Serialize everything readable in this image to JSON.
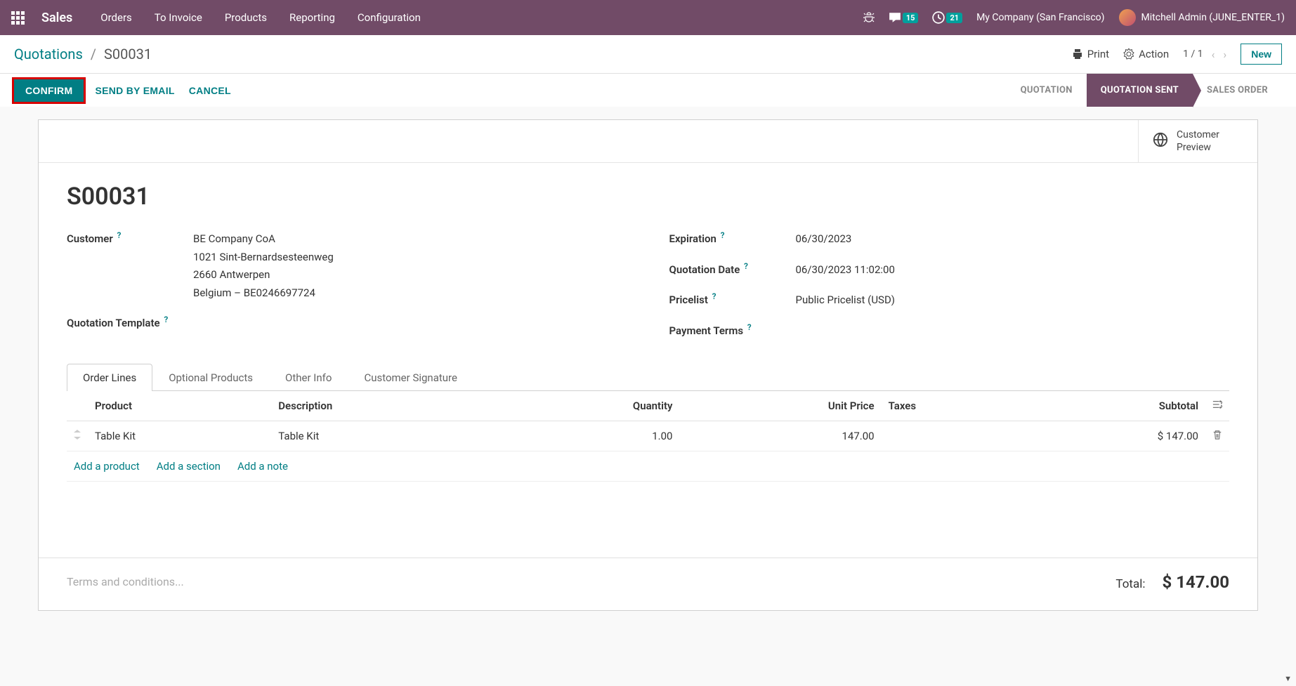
{
  "nav": {
    "app_name": "Sales",
    "menu": [
      "Orders",
      "To Invoice",
      "Products",
      "Reporting",
      "Configuration"
    ],
    "messages_count": "15",
    "activities_count": "21",
    "company": "My Company (San Francisco)",
    "user": "Mitchell Admin (JUNE_ENTER_1)"
  },
  "breadcrumb": {
    "root": "Quotations",
    "current": "S00031",
    "print": "Print",
    "action": "Action",
    "pager": "1 / 1",
    "new_btn": "New"
  },
  "actions": {
    "confirm": "CONFIRM",
    "send_email": "SEND BY EMAIL",
    "cancel": "CANCEL"
  },
  "status": {
    "quotation": "QUOTATION",
    "quotation_sent": "QUOTATION SENT",
    "sales_order": "SALES ORDER"
  },
  "stat_button": {
    "line1": "Customer",
    "line2": "Preview"
  },
  "record": {
    "name": "S00031",
    "labels": {
      "customer": "Customer",
      "quotation_template": "Quotation Template",
      "expiration": "Expiration",
      "quotation_date": "Quotation Date",
      "pricelist": "Pricelist",
      "payment_terms": "Payment Terms"
    },
    "customer": {
      "name": "BE Company CoA",
      "street": "1021 Sint-Bernardsesteenweg",
      "city": "2660 Antwerpen",
      "country_vat": "Belgium – BE0246697724"
    },
    "expiration": "06/30/2023",
    "quotation_date": "06/30/2023 11:02:00",
    "pricelist": "Public Pricelist (USD)",
    "payment_terms": ""
  },
  "tabs": [
    "Order Lines",
    "Optional Products",
    "Other Info",
    "Customer Signature"
  ],
  "table": {
    "headers": {
      "product": "Product",
      "description": "Description",
      "quantity": "Quantity",
      "unit_price": "Unit Price",
      "taxes": "Taxes",
      "subtotal": "Subtotal"
    },
    "rows": [
      {
        "product": "Table Kit",
        "description": "Table Kit",
        "quantity": "1.00",
        "unit_price": "147.00",
        "taxes": "",
        "subtotal": "$ 147.00"
      }
    ],
    "add": {
      "product": "Add a product",
      "section": "Add a section",
      "note": "Add a note"
    }
  },
  "footer": {
    "terms_placeholder": "Terms and conditions...",
    "total_label": "Total:",
    "total_value": "$ 147.00"
  }
}
